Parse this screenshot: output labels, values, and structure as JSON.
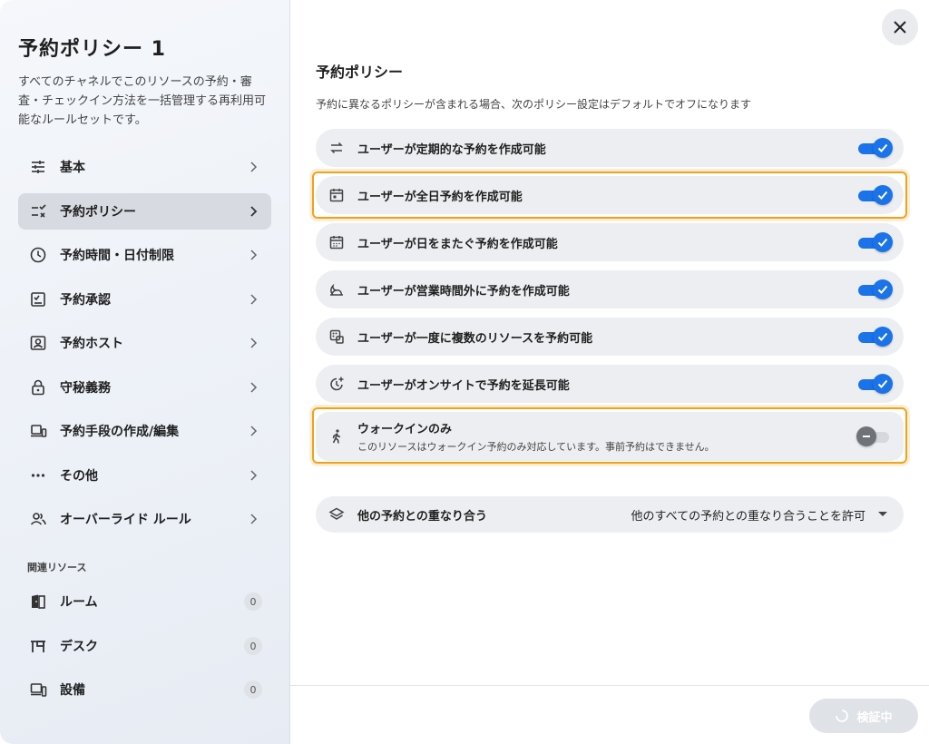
{
  "sidebar": {
    "title": "予約ポリシー 1",
    "description": "すべてのチャネルでこのリソースの予約・審査・チェックイン方法を一括管理する再利用可能なルールセットです。",
    "items": [
      {
        "label": "基本",
        "icon": "tune-icon"
      },
      {
        "label": "予約ポリシー",
        "icon": "checklist-icon",
        "active": true
      },
      {
        "label": "予約時間・日付制限",
        "icon": "clock-icon"
      },
      {
        "label": "予約承認",
        "icon": "approval-icon"
      },
      {
        "label": "予約ホスト",
        "icon": "host-icon"
      },
      {
        "label": "守秘義務",
        "icon": "lock-icon"
      },
      {
        "label": "予約手段の作成/編集",
        "icon": "devices-icon"
      },
      {
        "label": "その他",
        "icon": "more-icon"
      },
      {
        "label": "オーバーライド ルール",
        "icon": "people-icon"
      }
    ],
    "resources_label": "関連リソース",
    "resources": [
      {
        "label": "ルーム",
        "count": "0",
        "icon": "door-icon"
      },
      {
        "label": "デスク",
        "count": "0",
        "icon": "desk-icon"
      },
      {
        "label": "設備",
        "count": "0",
        "icon": "equipment-icon"
      }
    ]
  },
  "main": {
    "heading": "予約ポリシー",
    "note": "予約に異なるポリシーが含まれる場合、次のポリシー設定はデフォルトでオフになります",
    "policies": [
      {
        "label": "ユーザーが定期的な予約を作成可能",
        "icon": "repeat-icon",
        "on": true
      },
      {
        "label": "ユーザーが全日予約を作成可能",
        "icon": "calendar-icon",
        "on": true,
        "highlighted": true
      },
      {
        "label": "ユーザーが日をまたぐ予約を作成可能",
        "icon": "calendar-range-icon",
        "on": true
      },
      {
        "label": "ユーザーが営業時間外に予約を作成可能",
        "icon": "night-icon",
        "on": true
      },
      {
        "label": "ユーザーが一度に複数のリソースを予約可能",
        "icon": "multi-resource-icon",
        "on": true
      },
      {
        "label": "ユーザーがオンサイトで予約を延長可能",
        "icon": "extend-time-icon",
        "on": true
      }
    ],
    "walkin": {
      "label": "ウォークインのみ",
      "sub": "このリソースはウォークイン予約のみ対応しています。事前予約はできません。",
      "on": false
    },
    "overlap": {
      "label": "他の予約との重なり合う",
      "value": "他のすべての予約との重なり合うことを許可"
    },
    "verify_button": "検証中"
  },
  "colors": {
    "accent": "#1a73e8",
    "highlight": "#f1a21b"
  }
}
